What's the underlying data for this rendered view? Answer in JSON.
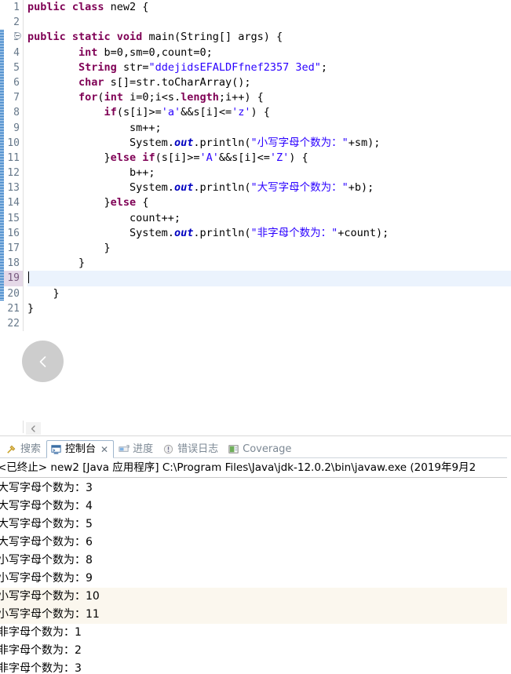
{
  "editor": {
    "line_numbers": [
      "1",
      "2",
      "3",
      "4",
      "5",
      "6",
      "7",
      "8",
      "9",
      "10",
      "11",
      "12",
      "13",
      "14",
      "15",
      "16",
      "17",
      "18",
      "19",
      "20",
      "21",
      "22"
    ],
    "current_line": "19",
    "lines": [
      {
        "n": "1",
        "segs": [
          {
            "t": "public class ",
            "c": "kw"
          },
          {
            "t": "new2 {",
            "c": "plain"
          }
        ]
      },
      {
        "n": "2",
        "segs": []
      },
      {
        "n": "3",
        "segs": [
          {
            "t": "public static void ",
            "c": "kw"
          },
          {
            "t": "main(String[] args) {",
            "c": "plain"
          }
        ]
      },
      {
        "n": "4",
        "segs": [
          {
            "t": "        ",
            "c": "plain"
          },
          {
            "t": "int",
            "c": "kw"
          },
          {
            "t": " b=0,sm=0,count=0;",
            "c": "plain"
          }
        ]
      },
      {
        "n": "5",
        "segs": [
          {
            "t": "        ",
            "c": "plain"
          },
          {
            "t": "String",
            "c": "kw"
          },
          {
            "t": " str=",
            "c": "plain"
          },
          {
            "t": "\"ddejidsEFALDFfnef2357 3ed\"",
            "c": "str"
          },
          {
            "t": ";",
            "c": "plain"
          }
        ]
      },
      {
        "n": "6",
        "segs": [
          {
            "t": "        ",
            "c": "plain"
          },
          {
            "t": "char",
            "c": "kw"
          },
          {
            "t": " s[]=str.toCharArray();",
            "c": "plain"
          }
        ]
      },
      {
        "n": "7",
        "segs": [
          {
            "t": "        ",
            "c": "plain"
          },
          {
            "t": "for",
            "c": "kw"
          },
          {
            "t": "(",
            "c": "plain"
          },
          {
            "t": "int",
            "c": "kw"
          },
          {
            "t": " i=0;i<s.",
            "c": "plain"
          },
          {
            "t": "length",
            "c": "kw"
          },
          {
            "t": ";i++) {",
            "c": "plain"
          }
        ]
      },
      {
        "n": "8",
        "segs": [
          {
            "t": "            ",
            "c": "plain"
          },
          {
            "t": "if",
            "c": "kw"
          },
          {
            "t": "(s[i]>=",
            "c": "plain"
          },
          {
            "t": "'a'",
            "c": "str"
          },
          {
            "t": "&&s[i]<=",
            "c": "plain"
          },
          {
            "t": "'z'",
            "c": "str"
          },
          {
            "t": ") {",
            "c": "plain"
          }
        ]
      },
      {
        "n": "9",
        "segs": [
          {
            "t": "                sm++;",
            "c": "plain"
          }
        ]
      },
      {
        "n": "10",
        "segs": [
          {
            "t": "                System.",
            "c": "plain"
          },
          {
            "t": "out",
            "c": "fld"
          },
          {
            "t": ".println(",
            "c": "plain"
          },
          {
            "t": "\"小写字母个数为：\"",
            "c": "str"
          },
          {
            "t": "+sm);",
            "c": "plain"
          }
        ]
      },
      {
        "n": "11",
        "segs": [
          {
            "t": "            }",
            "c": "plain"
          },
          {
            "t": "else if",
            "c": "kw"
          },
          {
            "t": "(s[i]>=",
            "c": "plain"
          },
          {
            "t": "'A'",
            "c": "str"
          },
          {
            "t": "&&s[i]<=",
            "c": "plain"
          },
          {
            "t": "'Z'",
            "c": "str"
          },
          {
            "t": ") {",
            "c": "plain"
          }
        ]
      },
      {
        "n": "12",
        "segs": [
          {
            "t": "                b++;",
            "c": "plain"
          }
        ]
      },
      {
        "n": "13",
        "segs": [
          {
            "t": "                System.",
            "c": "plain"
          },
          {
            "t": "out",
            "c": "fld"
          },
          {
            "t": ".println(",
            "c": "plain"
          },
          {
            "t": "\"大写字母个数为：\"",
            "c": "str"
          },
          {
            "t": "+b);",
            "c": "plain"
          }
        ]
      },
      {
        "n": "14",
        "segs": [
          {
            "t": "            }",
            "c": "plain"
          },
          {
            "t": "else",
            "c": "kw"
          },
          {
            "t": " {",
            "c": "plain"
          }
        ]
      },
      {
        "n": "15",
        "segs": [
          {
            "t": "                count++;",
            "c": "plain"
          }
        ]
      },
      {
        "n": "16",
        "segs": [
          {
            "t": "                System.",
            "c": "plain"
          },
          {
            "t": "out",
            "c": "fld"
          },
          {
            "t": ".println(",
            "c": "plain"
          },
          {
            "t": "\"非字母个数为：\"",
            "c": "str"
          },
          {
            "t": "+count);",
            "c": "plain"
          }
        ]
      },
      {
        "n": "17",
        "segs": [
          {
            "t": "            }",
            "c": "plain"
          }
        ]
      },
      {
        "n": "18",
        "segs": [
          {
            "t": "        }",
            "c": "plain"
          }
        ]
      },
      {
        "n": "19",
        "segs": []
      },
      {
        "n": "20",
        "segs": [
          {
            "t": "    }",
            "c": "plain"
          }
        ]
      },
      {
        "n": "21",
        "segs": [
          {
            "t": "}",
            "c": "plain"
          }
        ]
      },
      {
        "n": "22",
        "segs": []
      }
    ],
    "back_button_label": "back",
    "collapse_button_label": "collapse"
  },
  "console": {
    "tabs": [
      {
        "label": "搜索",
        "icon": "search-icon",
        "active": false,
        "closable": false
      },
      {
        "label": "控制台",
        "icon": "console-icon",
        "active": true,
        "closable": true
      },
      {
        "label": "进度",
        "icon": "progress-icon",
        "active": false,
        "closable": false
      },
      {
        "label": "错误日志",
        "icon": "error-log-icon",
        "active": false,
        "closable": false
      },
      {
        "label": "Coverage",
        "icon": "coverage-icon",
        "active": false,
        "closable": false
      }
    ],
    "close_glyph": "✕",
    "process_line": "<已终止> new2 [Java 应用程序] C:\\Program Files\\Java\\jdk-12.0.2\\bin\\javaw.exe  (2019年9月2",
    "output_lines": [
      {
        "text": "大写字母个数为：3",
        "highlight": false
      },
      {
        "text": "大写字母个数为：4",
        "highlight": false
      },
      {
        "text": "大写字母个数为：5",
        "highlight": false
      },
      {
        "text": "大写字母个数为：6",
        "highlight": false
      },
      {
        "text": "小写字母个数为：8",
        "highlight": false
      },
      {
        "text": "小写字母个数为：9",
        "highlight": false
      },
      {
        "text": "小写字母个数为：10",
        "highlight": true
      },
      {
        "text": "小写字母个数为：11",
        "highlight": true
      },
      {
        "text": "非字母个数为：1",
        "highlight": false
      },
      {
        "text": "非字母个数为：2",
        "highlight": false
      },
      {
        "text": "非字母个数为：3",
        "highlight": false
      }
    ]
  },
  "colors": {
    "keyword": "#7f0055",
    "string": "#2a00ff",
    "field": "#0000c0",
    "current_line_bg": "#ebf3fd",
    "gutter_current_bg": "#e5d9e8",
    "diff_ribbon": "#1f6fbf"
  }
}
